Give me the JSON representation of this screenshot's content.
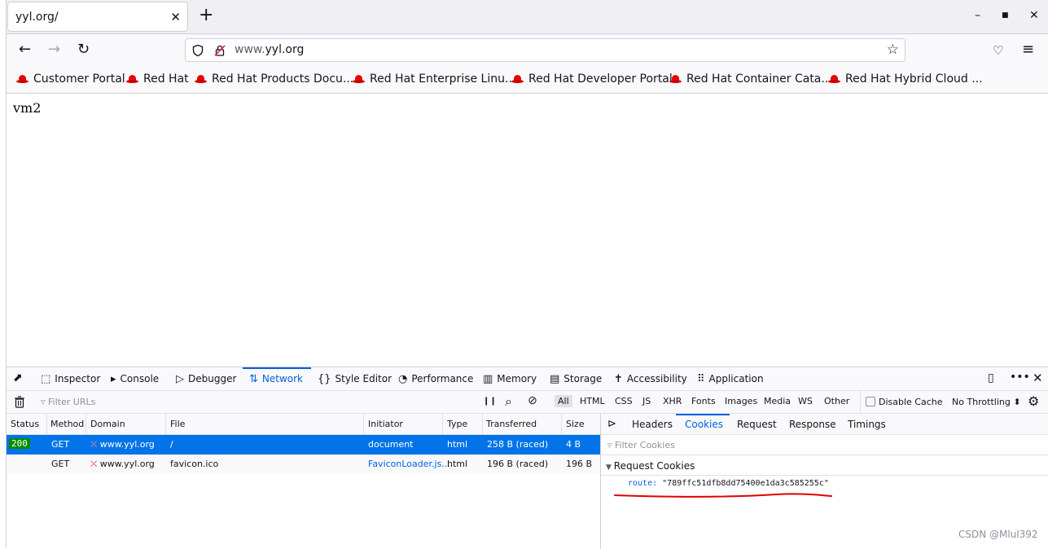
{
  "tab": {
    "title": "yyl.org/",
    "close": "✕",
    "new_tab": "+"
  },
  "window_controls": {
    "minimize": "–",
    "maximize": "■",
    "close": "✕"
  },
  "nav": {
    "back": "←",
    "forward": "→",
    "reload": "↻",
    "url_host_prefix": "www.",
    "url_host_domain": "yyl.org",
    "star": "☆",
    "pocket": "♡",
    "menu": "≡"
  },
  "bookmarks": [
    "Customer Portal",
    "Red Hat",
    "Red Hat Products Docu...",
    "Red Hat Enterprise Linu...",
    "Red Hat Developer Portal",
    "Red Hat Container Cata...",
    "Red Hat Hybrid Cloud ..."
  ],
  "page": {
    "text": "vm2"
  },
  "devtools": {
    "tabs": [
      {
        "icon": "⬚",
        "label": "Inspector"
      },
      {
        "icon": "▸",
        "label": "Console"
      },
      {
        "icon": "▷",
        "label": "Debugger"
      },
      {
        "icon": "⇅",
        "label": "Network"
      },
      {
        "icon": "{}",
        "label": "Style Editor"
      },
      {
        "icon": "◔",
        "label": "Performance"
      },
      {
        "icon": "▥",
        "label": "Memory"
      },
      {
        "icon": "▤",
        "label": "Storage"
      },
      {
        "icon": "✝",
        "label": "Accessibility"
      },
      {
        "icon": "⠿",
        "label": "Application"
      }
    ],
    "active_tab": "Network",
    "toolbar": {
      "filter_placeholder": "Filter URLs",
      "pause": "❙❙",
      "search": "⌕",
      "block": "⊘",
      "types": [
        "All",
        "HTML",
        "CSS",
        "JS",
        "XHR",
        "Fonts",
        "Images",
        "Media",
        "WS",
        "Other"
      ],
      "selected_type": "All",
      "disable_cache": "Disable Cache",
      "throttling": "No Throttling ⬍",
      "settings": "⚙"
    },
    "columns": [
      "Status",
      "Method",
      "Domain",
      "File",
      "Initiator",
      "Type",
      "Transferred",
      "Size"
    ],
    "requests": [
      {
        "status": "200",
        "method": "GET",
        "domain": "www.yyl.org",
        "file": "/",
        "initiator": "document",
        "type": "html",
        "transferred": "258 B (raced)",
        "size": "4 B"
      },
      {
        "status": "",
        "method": "GET",
        "domain": "www.yyl.org",
        "file": "favicon.ico",
        "initiator": "FaviconLoader.js...",
        "type": "html",
        "transferred": "196 B (raced)",
        "size": "196 B"
      }
    ],
    "side_tabs": [
      "Headers",
      "Cookies",
      "Request",
      "Response",
      "Timings"
    ],
    "active_side_tab": "Cookies",
    "cookie_filter_placeholder": "Filter Cookies",
    "cookie_section": "Request Cookies",
    "cookie": {
      "name": "route:",
      "value": "\"789ffc51dfb8dd75400e1da3c585255c\""
    }
  },
  "watermark": "CSDN @Mlul392",
  "colors": {
    "accent": "#0061e0",
    "selection": "#0074e8",
    "status_ok": "#058b00",
    "annotation": "#e00000"
  }
}
